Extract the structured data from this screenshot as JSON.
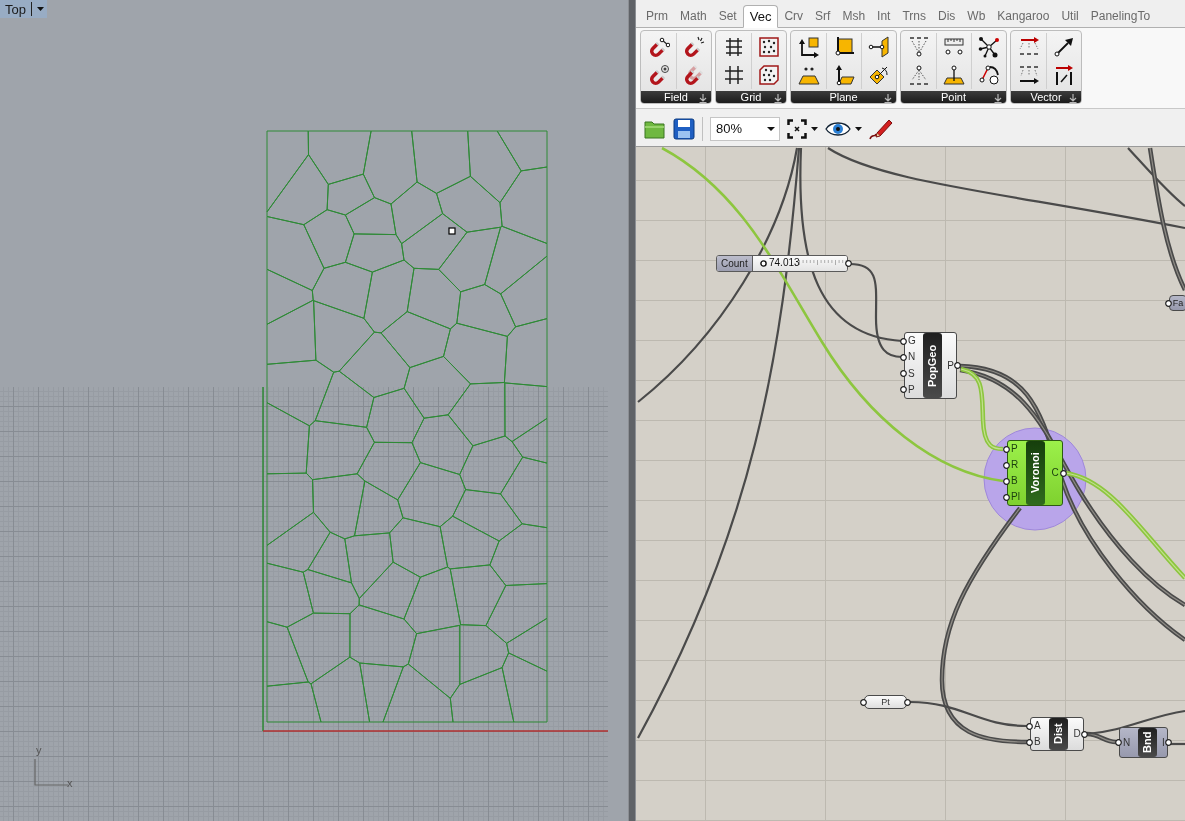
{
  "viewport": {
    "title": "Top",
    "axis_labels": [
      "y",
      "x"
    ]
  },
  "tabs": [
    {
      "label": "Prm",
      "selected": false
    },
    {
      "label": "Math",
      "selected": false
    },
    {
      "label": "Set",
      "selected": false
    },
    {
      "label": "Vec",
      "selected": true
    },
    {
      "label": "Crv",
      "selected": false
    },
    {
      "label": "Srf",
      "selected": false
    },
    {
      "label": "Msh",
      "selected": false
    },
    {
      "label": "Int",
      "selected": false
    },
    {
      "label": "Trns",
      "selected": false
    },
    {
      "label": "Dis",
      "selected": false
    },
    {
      "label": "Wb",
      "selected": false
    },
    {
      "label": "Kangaroo",
      "selected": false
    },
    {
      "label": "Util",
      "selected": false
    },
    {
      "label": "PanelingTo",
      "selected": false
    }
  ],
  "ribbon_groups": [
    {
      "label": "Field"
    },
    {
      "label": "Grid"
    },
    {
      "label": "Plane"
    },
    {
      "label": "Point"
    },
    {
      "label": "Vector"
    }
  ],
  "toolbar": {
    "zoom": "80%"
  },
  "canvas": {
    "slider": {
      "label": "Count",
      "value": "74.013",
      "level": 0.05
    },
    "components": [
      {
        "name": "PopGeo",
        "inputs": [
          "G",
          "N",
          "S",
          "P"
        ],
        "outputs": [
          "P"
        ],
        "selected": false,
        "preview": true,
        "highlighted": false
      },
      {
        "name": "Voronoi",
        "inputs": [
          "P",
          "R",
          "B",
          "Pl"
        ],
        "outputs": [
          "C"
        ],
        "selected": true,
        "preview": true,
        "highlighted": true
      },
      {
        "name": "Dist",
        "inputs": [
          "A",
          "B"
        ],
        "outputs": [
          "D"
        ],
        "selected": false,
        "preview": true,
        "highlighted": false
      },
      {
        "name": "Bnd",
        "inputs": [
          "N"
        ],
        "outputs": [
          "I"
        ],
        "selected": false,
        "preview": false,
        "highlighted": false
      }
    ],
    "params": [
      {
        "name": "Pt",
        "preview": true
      },
      {
        "name": "Fa",
        "preview": false
      }
    ]
  }
}
